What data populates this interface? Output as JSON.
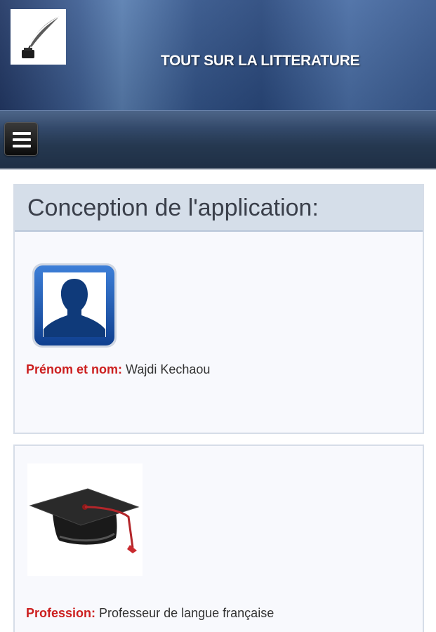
{
  "header": {
    "logo_icon": "quill-inkwell-icon",
    "title": "TOUT SUR LA LITTERATURE"
  },
  "navbar": {
    "menu_icon": "hamburger-menu-icon"
  },
  "section": {
    "title": "Conception de l'application:"
  },
  "author": {
    "avatar_icon": "user-silhouette-icon",
    "name_label": "Prénom et nom:",
    "name_value": "Wajdi Kechaou"
  },
  "profession": {
    "icon": "graduation-cap-icon",
    "label": "Profession:",
    "value": "Professeur de langue française"
  },
  "colors": {
    "label_red": "#cc1f1f",
    "header_blue": "#34558a",
    "card_bg": "#f8f9fd",
    "card_header_bg": "#d5dee9"
  }
}
